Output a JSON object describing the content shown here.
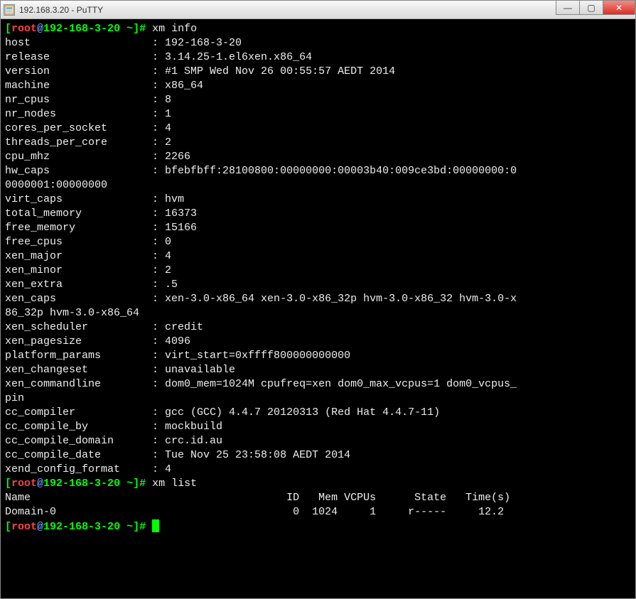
{
  "window": {
    "title": "192.168.3.20 - PuTTY"
  },
  "lines": [
    "[<red>root</red><blue>@</blue>192-168-3-20 ~]# xm info",
    "host                   : 192-168-3-20",
    "release                : 3.14.25-1.el6xen.x86_64",
    "version                : #1 SMP Wed Nov 26 00:55:57 AEDT 2014",
    "machine                : x86_64",
    "nr_cpus                : 8",
    "nr_nodes               : 1",
    "cores_per_socket       : 4",
    "threads_per_core       : 2",
    "cpu_mhz                : 2266",
    "hw_caps                : bfebfbff:28100800:00000000:00003b40:009ce3bd:00000000:0",
    "0000001:00000000",
    "virt_caps              : hvm",
    "total_memory           : 16373",
    "free_memory            : 15166",
    "free_cpus              : 0",
    "xen_major              : 4",
    "xen_minor              : 2",
    "xen_extra              : .5",
    "xen_caps               : xen-3.0-x86_64 xen-3.0-x86_32p hvm-3.0-x86_32 hvm-3.0-x",
    "86_32p hvm-3.0-x86_64",
    "xen_scheduler          : credit",
    "xen_pagesize           : 4096",
    "platform_params        : virt_start=0xffff800000000000",
    "xen_changeset          : unavailable",
    "xen_commandline        : dom0_mem=1024M cpufreq=xen dom0_max_vcpus=1 dom0_vcpus_",
    "pin",
    "cc_compiler            : gcc (GCC) 4.4.7 20120313 (Red Hat 4.4.7-11)",
    "cc_compile_by          : mockbuild",
    "cc_compile_domain      : crc.id.au",
    "cc_compile_date        : Tue Nov 25 23:58:08 AEDT 2014",
    "xend_config_format     : 4",
    "[<red>root</red><blue>@</blue>192-168-3-20 ~]# xm list",
    "Name                                        ID   Mem VCPUs      State   Time(s)",
    "Domain-0                                     0  1024     1     r-----     12.2",
    "[<red>root</red><blue>@</blue>192-168-3-20 ~]# <cursor></cursor>"
  ],
  "chart_data": {
    "type": "table",
    "title": "xm info",
    "rows": [
      {
        "key": "host",
        "value": "192-168-3-20"
      },
      {
        "key": "release",
        "value": "3.14.25-1.el6xen.x86_64"
      },
      {
        "key": "version",
        "value": "#1 SMP Wed Nov 26 00:55:57 AEDT 2014"
      },
      {
        "key": "machine",
        "value": "x86_64"
      },
      {
        "key": "nr_cpus",
        "value": "8"
      },
      {
        "key": "nr_nodes",
        "value": "1"
      },
      {
        "key": "cores_per_socket",
        "value": "4"
      },
      {
        "key": "threads_per_core",
        "value": "2"
      },
      {
        "key": "cpu_mhz",
        "value": "2266"
      },
      {
        "key": "hw_caps",
        "value": "bfebfbff:28100800:00000000:00003b40:009ce3bd:00000000:00000001:00000000"
      },
      {
        "key": "virt_caps",
        "value": "hvm"
      },
      {
        "key": "total_memory",
        "value": "16373"
      },
      {
        "key": "free_memory",
        "value": "15166"
      },
      {
        "key": "free_cpus",
        "value": "0"
      },
      {
        "key": "xen_major",
        "value": "4"
      },
      {
        "key": "xen_minor",
        "value": "2"
      },
      {
        "key": "xen_extra",
        "value": ".5"
      },
      {
        "key": "xen_caps",
        "value": "xen-3.0-x86_64 xen-3.0-x86_32p hvm-3.0-x86_32 hvm-3.0-x86_32p hvm-3.0-x86_64"
      },
      {
        "key": "xen_scheduler",
        "value": "credit"
      },
      {
        "key": "xen_pagesize",
        "value": "4096"
      },
      {
        "key": "platform_params",
        "value": "virt_start=0xffff800000000000"
      },
      {
        "key": "xen_changeset",
        "value": "unavailable"
      },
      {
        "key": "xen_commandline",
        "value": "dom0_mem=1024M cpufreq=xen dom0_max_vcpus=1 dom0_vcpus_pin"
      },
      {
        "key": "cc_compiler",
        "value": "gcc (GCC) 4.4.7 20120313 (Red Hat 4.4.7-11)"
      },
      {
        "key": "cc_compile_by",
        "value": "mockbuild"
      },
      {
        "key": "cc_compile_domain",
        "value": "crc.id.au"
      },
      {
        "key": "cc_compile_date",
        "value": "Tue Nov 25 23:58:08 AEDT 2014"
      },
      {
        "key": "xend_config_format",
        "value": "4"
      }
    ],
    "xm_list": {
      "columns": [
        "Name",
        "ID",
        "Mem",
        "VCPUs",
        "State",
        "Time(s)"
      ],
      "rows": [
        {
          "Name": "Domain-0",
          "ID": 0,
          "Mem": 1024,
          "VCPUs": 1,
          "State": "r-----",
          "Time(s)": 12.2
        }
      ]
    }
  }
}
